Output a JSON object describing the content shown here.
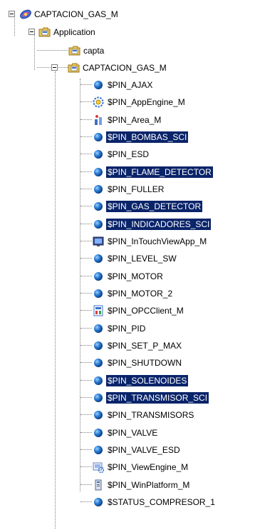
{
  "tree": {
    "root": {
      "label": "CAPTACION_GAS_M",
      "icon": "galaxy-icon"
    },
    "application": {
      "label": "Application",
      "icon": "folder-icon"
    },
    "capta": {
      "label": "capta",
      "icon": "folder-icon"
    },
    "group": {
      "label": "CAPTACION_GAS_M",
      "icon": "folder-icon"
    },
    "items": [
      {
        "label": "$PIN_AJAX",
        "icon": "instance-ball-icon",
        "selected": false
      },
      {
        "label": "$PIN_AppEngine_M",
        "icon": "appengine-icon",
        "selected": false
      },
      {
        "label": "$PIN_Area_M",
        "icon": "area-icon",
        "selected": false
      },
      {
        "label": "$PIN_BOMBAS_SCI",
        "icon": "instance-ball-icon",
        "selected": true
      },
      {
        "label": "$PIN_ESD",
        "icon": "instance-ball-icon",
        "selected": false
      },
      {
        "label": "$PIN_FLAME_DETECTOR",
        "icon": "instance-ball-icon",
        "selected": true
      },
      {
        "label": "$PIN_FULLER",
        "icon": "instance-ball-icon",
        "selected": false
      },
      {
        "label": "$PIN_GAS_DETECTOR",
        "icon": "instance-ball-icon",
        "selected": true
      },
      {
        "label": "$PIN_INDICADORES_SCI",
        "icon": "instance-ball-icon",
        "selected": true
      },
      {
        "label": "$PIN_InTouchViewApp_M",
        "icon": "intouch-view-icon",
        "selected": false
      },
      {
        "label": "$PIN_LEVEL_SW",
        "icon": "instance-ball-icon",
        "selected": false
      },
      {
        "label": "$PIN_MOTOR",
        "icon": "instance-ball-icon",
        "selected": false
      },
      {
        "label": "$PIN_MOTOR_2",
        "icon": "instance-ball-icon",
        "selected": false
      },
      {
        "label": "$PIN_OPCClient_M",
        "icon": "opc-client-icon",
        "selected": false
      },
      {
        "label": "$PIN_PID",
        "icon": "instance-ball-icon",
        "selected": false
      },
      {
        "label": "$PIN_SET_P_MAX",
        "icon": "instance-ball-icon",
        "selected": false
      },
      {
        "label": "$PIN_SHUTDOWN",
        "icon": "instance-ball-icon",
        "selected": false
      },
      {
        "label": "$PIN_SOLENOIDES",
        "icon": "instance-ball-icon",
        "selected": true
      },
      {
        "label": "$PIN_TRANSMISOR_SCI",
        "icon": "instance-ball-icon",
        "selected": true
      },
      {
        "label": "$PIN_TRANSMISORS",
        "icon": "instance-ball-icon",
        "selected": false
      },
      {
        "label": "$PIN_VALVE",
        "icon": "instance-ball-icon",
        "selected": false
      },
      {
        "label": "$PIN_VALVE_ESD",
        "icon": "instance-ball-icon",
        "selected": false
      },
      {
        "label": "$PIN_ViewEngine_M",
        "icon": "viewengine-icon",
        "selected": false
      },
      {
        "label": "$PIN_WinPlatform_M",
        "icon": "winplatform-icon",
        "selected": false
      },
      {
        "label": "$STATUS_COMPRESOR_1",
        "icon": "instance-ball-icon",
        "selected": false
      }
    ]
  },
  "colors": {
    "selection": "#0a246a",
    "ball": "#1f73c8",
    "folder": "#e8c15a"
  }
}
